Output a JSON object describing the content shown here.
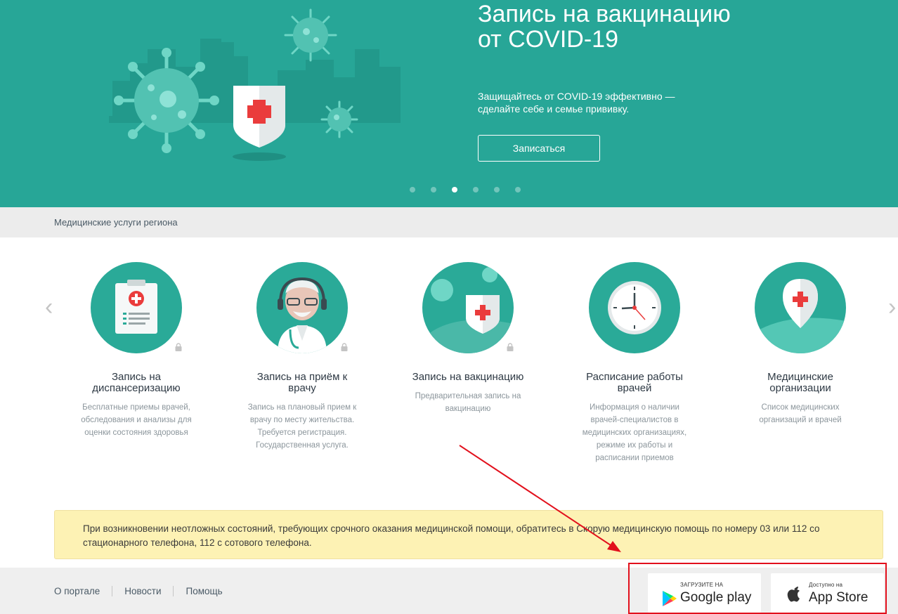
{
  "hero": {
    "title": "Запись на вакцинацию от COVID-19",
    "subtitle": "Защищайтесь от COVID-19 эффективно — сделайте себе и семье прививку.",
    "button_label": "Записаться",
    "slides_total": 6,
    "active_slide": 3
  },
  "section": {
    "title": "Медицинские услуги региона"
  },
  "services": [
    {
      "title": "Запись на диспансеризацию",
      "description": "Бесплатные приемы врачей, обследования и анализы для оценки состояния здоровья",
      "icon": "clipboard-icon",
      "locked": true
    },
    {
      "title": "Запись на приём к врачу",
      "description": "Запись на плановый прием к врачу по месту жительства. Требуется регистрация. Государственная услуга.",
      "icon": "doctor-icon",
      "locked": true
    },
    {
      "title": "Запись на вакцинацию",
      "description": "Предварительная запись на вакцинацию",
      "icon": "vaccine-shield-icon",
      "locked": true
    },
    {
      "title": "Расписание работы врачей",
      "description": "Информация о наличии врачей-специалистов в медицинских организациях, режиме их работы и расписании приемов",
      "icon": "clock-icon",
      "locked": false
    },
    {
      "title": "Медицинские организации",
      "description": "Список медицинских организаций и врачей",
      "icon": "map-pin-icon",
      "locked": false
    }
  ],
  "notice": {
    "text": "При возникновении неотложных состояний, требующих срочного оказания медицинской помощи, обратитесь в Скорую медицинскую помощь по номеру 03 или 112 со стационарного телефона, 112 с сотового телефона."
  },
  "footer": {
    "links": [
      "О портале",
      "Новости",
      "Помощь"
    ],
    "google_play_small": "ЗАГРУЗИТЕ НА",
    "google_play_big": "Google play",
    "app_store_small": "Доступно на",
    "app_store_big": "App Store"
  },
  "colors": {
    "brand": "#27a697",
    "annotation": "#e2101c"
  }
}
